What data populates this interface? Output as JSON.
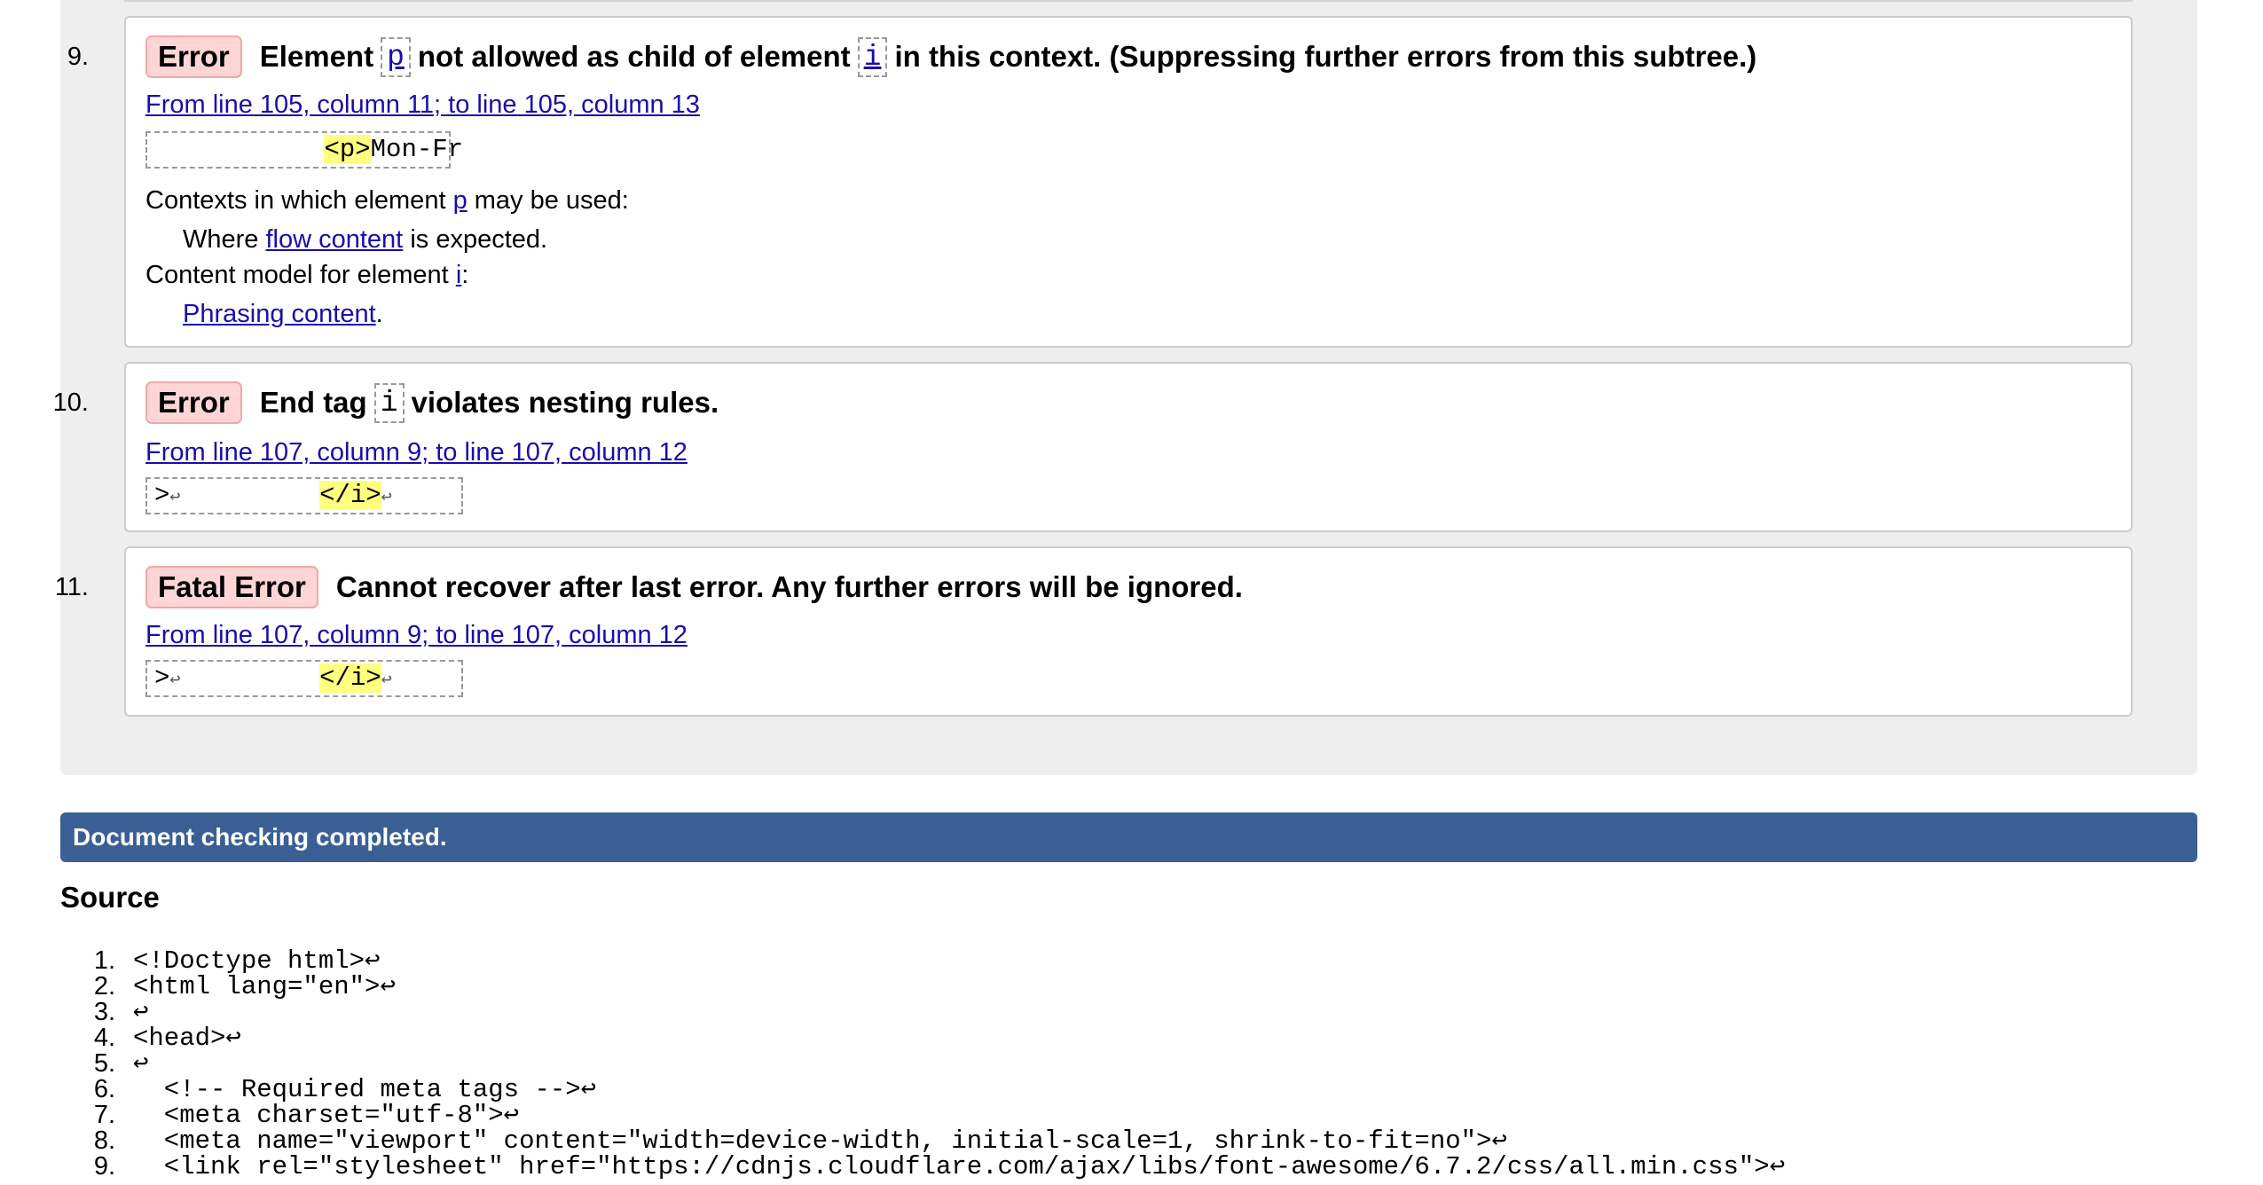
{
  "messages": [
    {
      "num": "9.",
      "type": "Error",
      "parts": {
        "p1": "Element",
        "code1": "p",
        "p2": "not allowed as child of element",
        "code2": "i",
        "p3": "in this context. (Suppressing further errors from this subtree.)"
      },
      "location": "From line 105, column 11; to line 105, column 13",
      "extract_pre": "           ",
      "extract_hl": "<p>",
      "extract_post": "Mon-Fr",
      "contexts_label_a": "Contexts in which element",
      "contexts_code": "p",
      "contexts_label_b": "may be used:",
      "contexts_where": "Where",
      "contexts_link": "flow content",
      "contexts_tail": "is expected.",
      "model_label_a": "Content model for element",
      "model_code": "i",
      "model_label_b": ":",
      "model_link": "Phrasing content",
      "model_tail": "."
    },
    {
      "num": "10.",
      "type": "Error",
      "parts": {
        "p1": "End tag",
        "code1": "i",
        "p2": "violates nesting rules."
      },
      "location": "From line 107, column 9; to line 107, column 12",
      "extract_pre": ">",
      "extract_mid": "         ",
      "extract_hl": "</i>",
      "lf": "↩"
    },
    {
      "num": "11.",
      "type": "Fatal Error",
      "parts": {
        "p1": "Cannot recover after last error. Any further errors will be ignored."
      },
      "location": "From line 107, column 9; to line 107, column 12",
      "extract_pre": ">",
      "extract_mid": "         ",
      "extract_hl": "</i>",
      "lf": "↩"
    }
  ],
  "status": "Document checking completed.",
  "source_title": "Source",
  "source_lines": [
    {
      "n": "1.",
      "code": "<!Doctype html>↩"
    },
    {
      "n": "2.",
      "code": "<html lang=\"en\">↩"
    },
    {
      "n": "3.",
      "code": "↩"
    },
    {
      "n": "4.",
      "code": "<head>↩"
    },
    {
      "n": "5.",
      "code": "↩"
    },
    {
      "n": "6.",
      "code": "  <!-- Required meta tags -->↩"
    },
    {
      "n": "7.",
      "code": "  <meta charset=\"utf-8\">↩"
    },
    {
      "n": "8.",
      "code": "  <meta name=\"viewport\" content=\"width=device-width, initial-scale=1, shrink-to-fit=no\">↩"
    },
    {
      "n": "9.",
      "code": "  <link rel=\"stylesheet\" href=\"https://cdnjs.cloudflare.com/ajax/libs/font-awesome/6.7.2/css/all.min.css\">↩"
    }
  ]
}
